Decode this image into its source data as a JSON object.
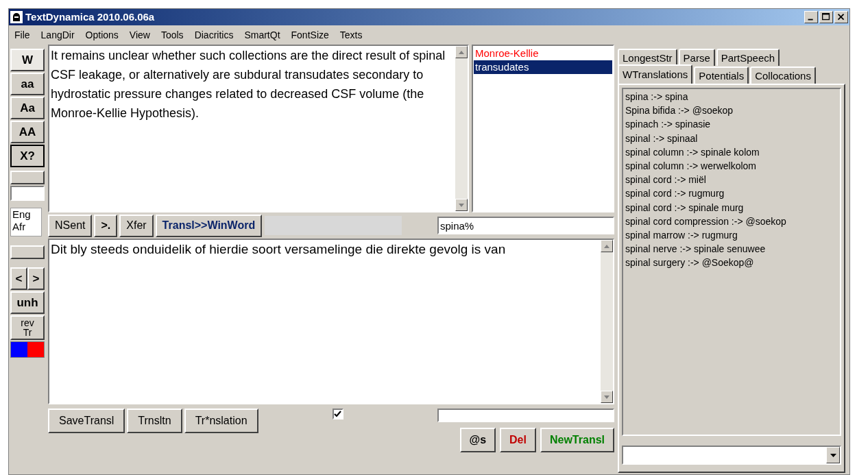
{
  "window": {
    "title": "TextDynamica 2010.06.06a"
  },
  "menu": [
    "File",
    "LangDir",
    "Options",
    "View",
    "Tools",
    "Diacritics",
    "SmartQt",
    "FontSize",
    "Texts"
  ],
  "left_toolbar": [
    {
      "kind": "button",
      "label": "W",
      "pressed": true
    },
    {
      "kind": "button",
      "label": "aa",
      "pressed": false
    },
    {
      "kind": "button",
      "label": "Aa",
      "pressed": false
    },
    {
      "kind": "button",
      "label": "AA",
      "pressed": false
    },
    {
      "kind": "button",
      "label": "X?",
      "pressed": false,
      "focused": true
    },
    {
      "kind": "blank"
    },
    {
      "kind": "field"
    },
    {
      "kind": "langs",
      "lines": [
        "Eng",
        "Afr"
      ]
    },
    {
      "kind": "blank"
    },
    {
      "kind": "pair",
      "labels": [
        "<",
        ">"
      ]
    },
    {
      "kind": "button",
      "label": "unh",
      "pressed": false
    },
    {
      "kind": "stack",
      "lines": [
        "rev",
        "Tr"
      ]
    },
    {
      "kind": "swatches",
      "swatches": [
        {
          "color": "#0000ff"
        },
        {
          "color": "#ff0000"
        }
      ]
    }
  ],
  "source_text": "It remains unclear whether such collections are the direct result of spinal CSF leakage, or alternatively are subdural transudates secondary to hydrostatic pressure changes related to decreased CSF volume (the Monroe-Kellie Hypothesis).",
  "term_list": [
    {
      "text": "Monroe-Kellie",
      "flagged": true,
      "selected": false
    },
    {
      "text": "transudates",
      "flagged": false,
      "selected": true
    }
  ],
  "middle_buttons": [
    {
      "label": "NSent",
      "color": "#000000",
      "bold": false
    },
    {
      "label": ">.",
      "color": "#000000",
      "bold": true
    },
    {
      "label": "Xfer",
      "color": "#000000",
      "bold": false
    },
    {
      "label": "Transl>>WinWord",
      "color": "#0a246a",
      "bold": true
    }
  ],
  "search_field": {
    "value": "spina%"
  },
  "translation_text": "Dit bly steeds onduidelik of hierdie soort versamelinge die direkte gevolg is van",
  "bottom_buttons": [
    {
      "label": "SaveTransl"
    },
    {
      "label": "Trnsltn"
    },
    {
      "label": "Tr*nslation"
    }
  ],
  "checkbox": {
    "checked": true
  },
  "action_buttons": [
    {
      "label": "@s",
      "color": "#000000"
    },
    {
      "label": "Del",
      "color": "#c00000"
    },
    {
      "label": "NewTransl",
      "color": "#008000"
    }
  ],
  "tab_rows": [
    [
      {
        "label": "LongestStr",
        "selected": false
      },
      {
        "label": "Parse",
        "selected": false
      },
      {
        "label": "PartSpeech",
        "selected": false
      }
    ],
    [
      {
        "label": "WTranslations",
        "selected": true
      },
      {
        "label": "Potentials",
        "selected": false
      },
      {
        "label": "Collocations",
        "selected": false
      }
    ]
  ],
  "translations": [
    "spina :-> spina",
    "Spina bifida :-> @soekop",
    "spinach :-> spinasie",
    "spinal :-> spinaal",
    "spinal column :-> spinale kolom",
    "spinal column :-> werwelkolom",
    "spinal cord :-> miël",
    "spinal cord :-> rugmurg",
    "spinal cord :-> spinale murg",
    "spinal cord compression :-> @soekop",
    "spinal marrow :-> rugmurg",
    "spinal nerve :-> spinale senuwee",
    "spinal surgery :-> @Soekop@"
  ]
}
